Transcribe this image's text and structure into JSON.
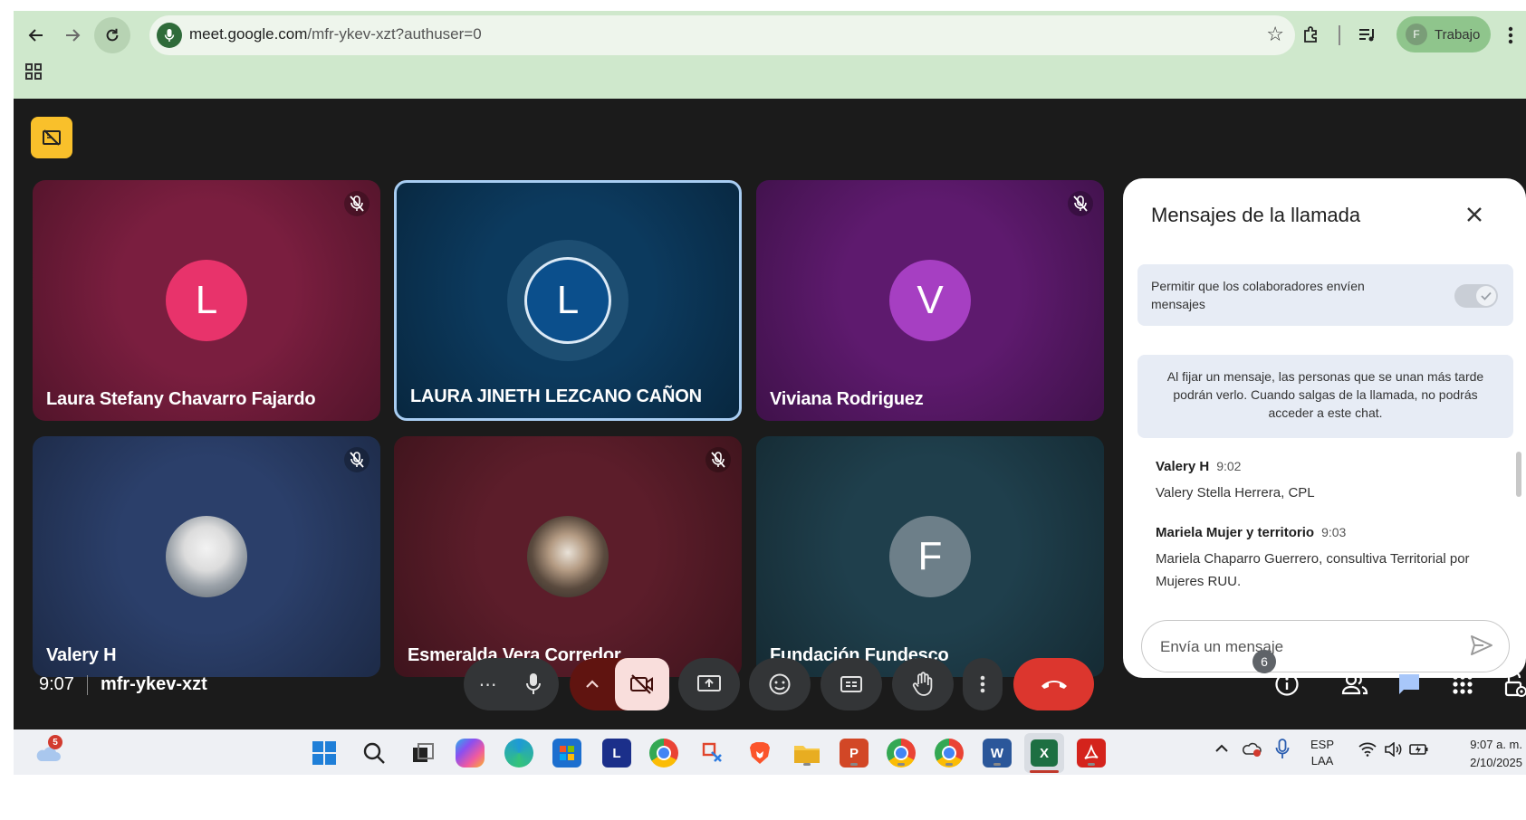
{
  "browser": {
    "url_host": "meet.google.com",
    "url_path": "/mfr-ykev-xzt?authuser=0",
    "profile_label": "Trabajo",
    "profile_initial": "F"
  },
  "participants": [
    {
      "name": "Laura Stefany Chavarro Fajardo",
      "initial": "L",
      "muted": true,
      "bg": "#7a1e3f",
      "avatar_color": "#e8336b"
    },
    {
      "name": "LAURA JINETH LEZCANO CAÑON",
      "initial": "L",
      "muted": false,
      "bg": "#0c3a5e",
      "avatar_color": "#0b4f8c",
      "speaking": true
    },
    {
      "name": "Viviana Rodriguez",
      "initial": "V",
      "muted": true,
      "bg": "#5e1a6e",
      "avatar_color": "#a63fc2"
    },
    {
      "name": "Valery H",
      "initial": "",
      "muted": true,
      "bg": "#2b3f6a",
      "photo": true
    },
    {
      "name": "Esmeralda Vera Corredor",
      "initial": "",
      "muted": true,
      "bg": "#5c1d2a",
      "photo": true
    },
    {
      "name": "Fundación Fundesco",
      "initial": "F",
      "muted": false,
      "bg": "#1f3f4c",
      "avatar_color": "#6d7f89"
    }
  ],
  "chat": {
    "title": "Mensajes de la llamada",
    "permission_text": "Permitir que los colaboradores envíen mensajes",
    "pin_note": "Al fijar un mensaje, las personas que se unan más tarde podrán verlo. Cuando salgas de la llamada, no podrás acceder a este chat.",
    "messages": [
      {
        "author": "Valery H",
        "time": "9:02",
        "text": "Valery Stella Herrera, CPL"
      },
      {
        "author": "Mariela Mujer y territorio",
        "time": "9:03",
        "text": "Mariela Chaparro Guerrero, consultiva Territorial por Mujeres RUU."
      }
    ],
    "input_placeholder": "Envía un mensaje"
  },
  "meeting": {
    "time": "9:07",
    "code": "mfr-ykev-xzt",
    "participants_count": "6"
  },
  "taskbar": {
    "weather_badge": "5",
    "lang_top": "ESP",
    "lang_bottom": "LAA",
    "clock_time": "9:07 a. m.",
    "clock_date": "2/10/2025"
  }
}
